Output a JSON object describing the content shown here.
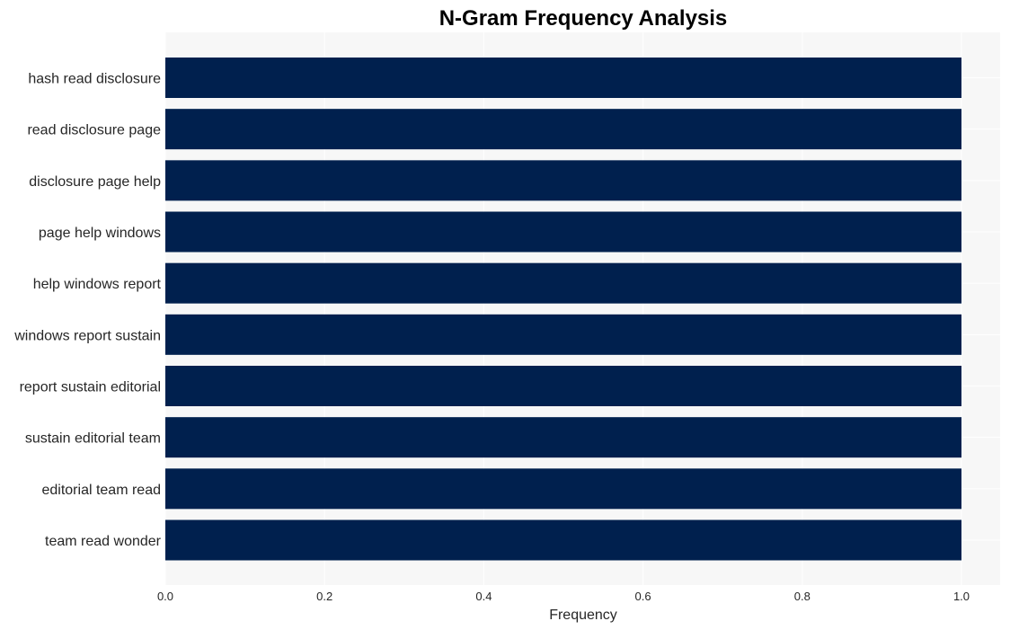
{
  "chart_data": {
    "type": "bar",
    "orientation": "horizontal",
    "title": "N-Gram Frequency Analysis",
    "xlabel": "Frequency",
    "ylabel": "",
    "categories": [
      "hash read disclosure",
      "read disclosure page",
      "disclosure page help",
      "page help windows",
      "help windows report",
      "windows report sustain",
      "report sustain editorial",
      "sustain editorial team",
      "editorial team read",
      "team read wonder"
    ],
    "values": [
      1,
      1,
      1,
      1,
      1,
      1,
      1,
      1,
      1,
      1
    ],
    "xlim": [
      0,
      1.05
    ],
    "xticks": [
      "0.0",
      "0.2",
      "0.4",
      "0.6",
      "0.8",
      "1.0"
    ],
    "xtick_values": [
      0,
      0.2,
      0.4,
      0.6,
      0.8,
      1.0
    ],
    "grid": true,
    "legend": "none",
    "colors": {
      "bar": "#00204e",
      "plot_background": "#f7f7f7",
      "grid": "#ffffff"
    }
  }
}
